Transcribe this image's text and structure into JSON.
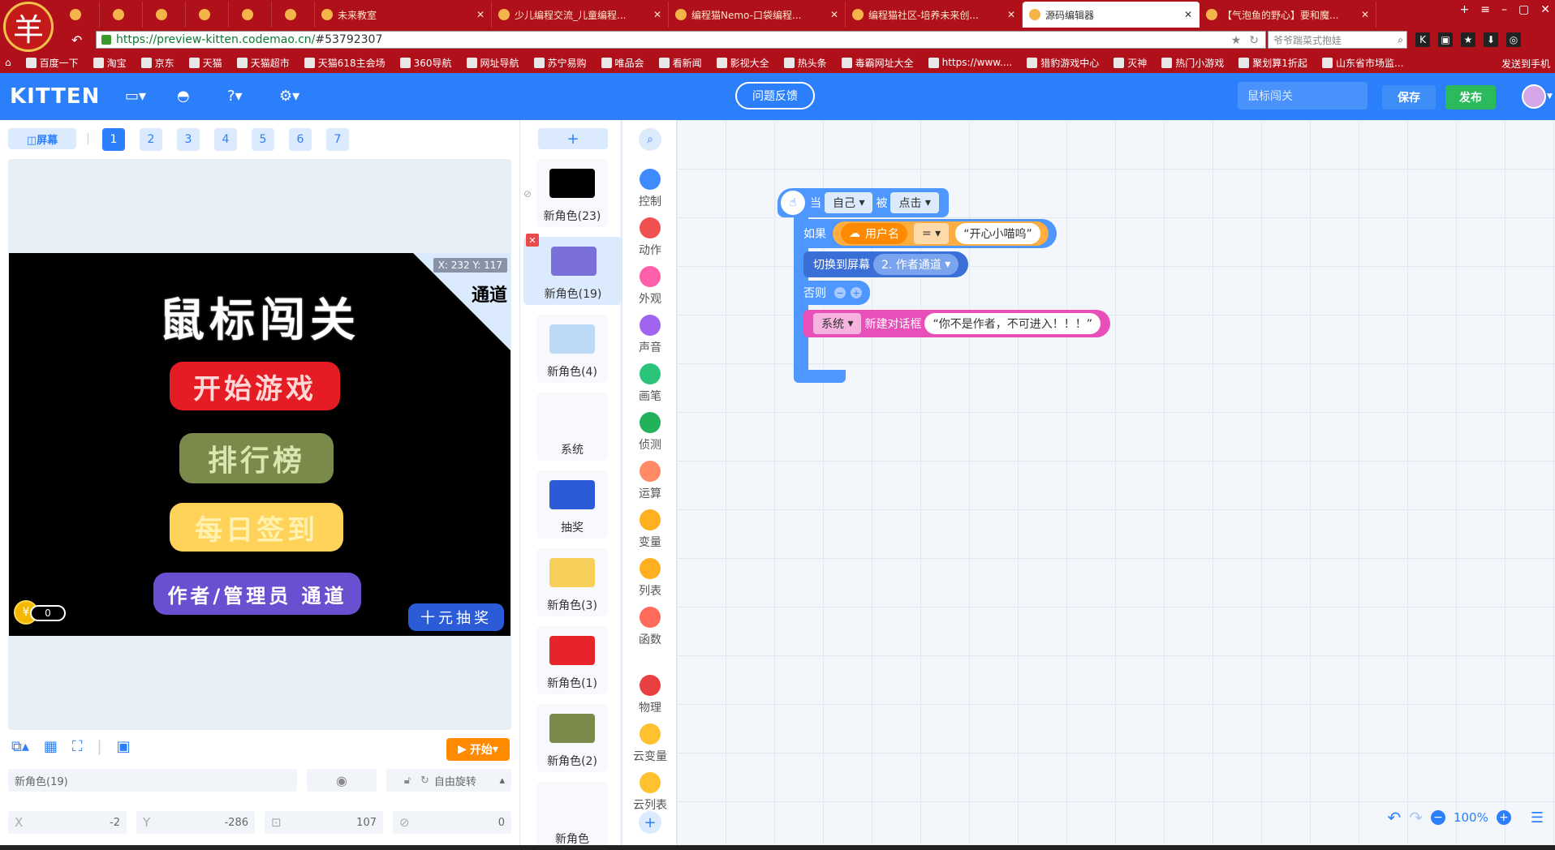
{
  "browser": {
    "logo_char": "羊",
    "tabs": [
      {
        "label": "",
        "kind": "small"
      },
      {
        "label": "",
        "kind": "small"
      },
      {
        "label": "",
        "kind": "small"
      },
      {
        "label": "",
        "kind": "small"
      },
      {
        "label": "",
        "kind": "small"
      },
      {
        "label": "",
        "kind": "small"
      },
      {
        "label": "未来教室",
        "kind": "wide"
      },
      {
        "label": "少儿编程交流_儿童编程...",
        "kind": "wide"
      },
      {
        "label": "编程猫Nemo-口袋编程...",
        "kind": "wide"
      },
      {
        "label": "编程猫社区-培养未来创...",
        "kind": "wide"
      },
      {
        "label": "源码编辑器",
        "kind": "wide",
        "active": true
      },
      {
        "label": "【气泡鱼的野心】要和魔...",
        "kind": "wide"
      }
    ],
    "url_host": "https://preview-kitten.codemao.cn/",
    "url_hash": "#53792307",
    "search_placeholder": "爷爷踹菜式抱娃",
    "bookmarks": [
      "百度一下",
      "淘宝",
      "京东",
      "天猫",
      "天猫超市",
      "天猫618主会场",
      "360导航",
      "网址导航",
      "苏宁易购",
      "唯品会",
      "看新闻",
      "影视大全",
      "热头条",
      "毒霸网址大全",
      "https://www....",
      "猎豹游戏中心",
      "灭神",
      "热门小游戏",
      "聚划算1折起",
      "山东省市场监..."
    ],
    "bookmarks_right": "发送到手机"
  },
  "header": {
    "logo": "KITTEN",
    "feedback_label": "问题反馈",
    "project_name": "鼠标闯关",
    "save_label": "保存",
    "publish_label": "发布"
  },
  "stage": {
    "screen_label": "◫屏幕",
    "screens": [
      "1",
      "2",
      "3",
      "4",
      "5",
      "6",
      "7"
    ],
    "active_screen": "1",
    "title": "鼠标闯关",
    "btn_start_game": "开始游戏",
    "btn_rank": "排行榜",
    "btn_signin": "每日签到",
    "btn_admin": "作者/管理员 通道",
    "corner_text": "通道",
    "coord_readout": "X: 232  Y: 117",
    "coin_count": "0",
    "lottery_label": "十元抽奖",
    "start_label": "开始"
  },
  "props": {
    "sprite_name": "新角色(19)",
    "rotate_label": "自由旋转",
    "x_label": "X",
    "x_value": "-2",
    "y_label": "Y",
    "y_value": "-286",
    "size_value": "107",
    "rotation_value": "0"
  },
  "sprites": [
    {
      "name": "新角色(23)",
      "color": "#000000"
    },
    {
      "name": "新角色(19)",
      "color": "#7b6fd8",
      "active": true
    },
    {
      "name": "新角色(4)",
      "color": "#bcd9f5"
    },
    {
      "name": "系统",
      "color": "#f7f9fc"
    },
    {
      "name": "抽奖",
      "color": "#2b5bd6"
    },
    {
      "name": "新角色(3)",
      "color": "#f6d05a"
    },
    {
      "name": "新角色(1)",
      "color": "#e8242b"
    },
    {
      "name": "新角色(2)",
      "color": "#7a8a4a"
    },
    {
      "name": "新角色",
      "color": "#f7f9fc"
    }
  ],
  "categories": [
    {
      "name": "控制",
      "color": "#3e8bff"
    },
    {
      "name": "动作",
      "color": "#f05050"
    },
    {
      "name": "外观",
      "color": "#ff5ea8"
    },
    {
      "name": "声音",
      "color": "#a064f0"
    },
    {
      "name": "画笔",
      "color": "#2cc47a"
    },
    {
      "name": "侦测",
      "color": "#22b35a"
    },
    {
      "name": "运算",
      "color": "#ff8a65"
    },
    {
      "name": "变量",
      "color": "#ffb020"
    },
    {
      "name": "列表",
      "color": "#ffb020"
    },
    {
      "name": "函数",
      "color": "#ff6a5a"
    },
    {
      "name": "物理",
      "color": "#e84040"
    },
    {
      "name": "云变量",
      "color": "#ffc130"
    },
    {
      "name": "云列表",
      "color": "#ffc130"
    }
  ],
  "blocks": {
    "when_label": "当",
    "self_label": "自己",
    "being_label": "被",
    "clicked_label": "点击",
    "if_label": "如果",
    "username_label": "用户名",
    "eq_label": "=",
    "compare_text": "“开心小喵呜”",
    "switch_label": "切换到屏幕",
    "switch_target": "2. 作者通道",
    "else_label": "否则",
    "system_label": "系统",
    "dialog_label": "新建对话框",
    "dialog_text": "“你不是作者，不可进入！！！”"
  },
  "zoom": {
    "value": "100%"
  }
}
